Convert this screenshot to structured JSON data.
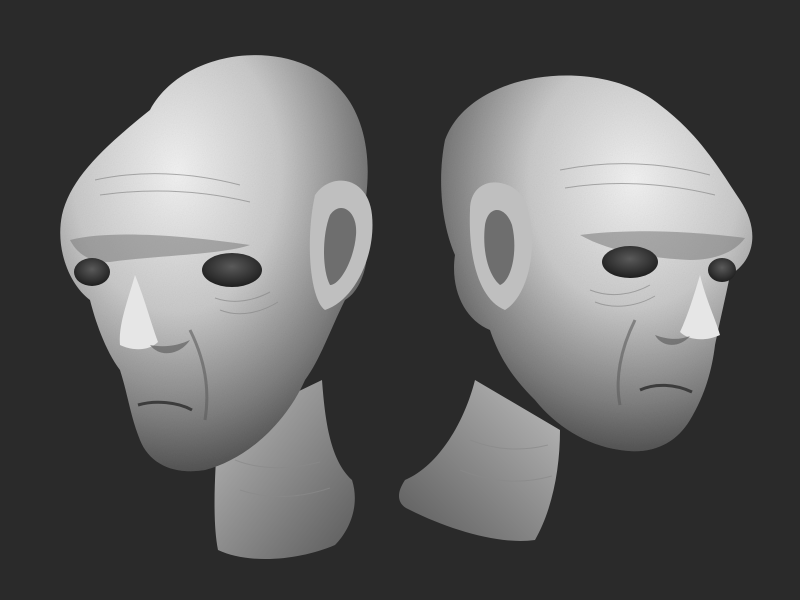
{
  "scene": {
    "background_color": "#2a2a2a",
    "material_color": "#d9d9d9",
    "subjects": [
      {
        "name": "alien-head-left-view",
        "facing": "left"
      },
      {
        "name": "alien-head-right-view",
        "facing": "right"
      }
    ]
  }
}
